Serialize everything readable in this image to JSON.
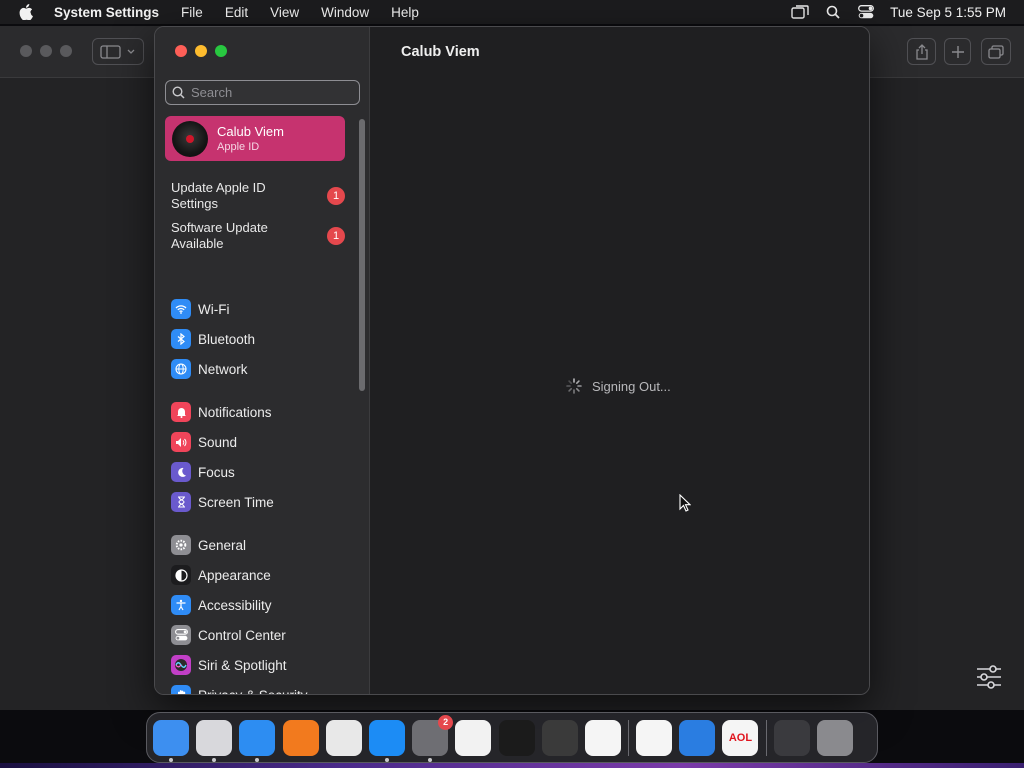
{
  "menubar": {
    "app_name": "System Settings",
    "items": [
      "File",
      "Edit",
      "View",
      "Window",
      "Help"
    ],
    "clock": "Tue Sep 5  1:55 PM",
    "icons": [
      "screen-mirroring-icon",
      "spotlight-search-icon",
      "control-center-icon"
    ]
  },
  "sidebar": {
    "search_placeholder": "Search",
    "account": {
      "name": "Calub Viem",
      "subtitle": "Apple ID"
    },
    "notices": [
      {
        "label": "Update Apple ID Settings",
        "badge": "1"
      },
      {
        "label": "Software Update Available",
        "badge": "1"
      }
    ],
    "items": [
      {
        "label": "Wi-Fi",
        "icon": "wifi-icon",
        "color": "#2f8cf6"
      },
      {
        "label": "Bluetooth",
        "icon": "bluetooth-icon",
        "color": "#2f8cf6"
      },
      {
        "label": "Network",
        "icon": "globe-icon",
        "color": "#2f8cf6"
      },
      {
        "label": "Notifications",
        "icon": "bell-icon",
        "color": "#f0455a"
      },
      {
        "label": "Sound",
        "icon": "speaker-icon",
        "color": "#f0455a"
      },
      {
        "label": "Focus",
        "icon": "moon-icon",
        "color": "#6a5acd"
      },
      {
        "label": "Screen Time",
        "icon": "hourglass-icon",
        "color": "#6a5acd"
      },
      {
        "label": "General",
        "icon": "gear-icon",
        "color": "#8e8e93"
      },
      {
        "label": "Appearance",
        "icon": "appearance-icon",
        "color": "#1c1c1e"
      },
      {
        "label": "Accessibility",
        "icon": "accessibility-icon",
        "color": "#2f8cf6"
      },
      {
        "label": "Control Center",
        "icon": "control-center-icon",
        "color": "#8e8e93"
      },
      {
        "label": "Siri & Spotlight",
        "icon": "siri-icon",
        "color": "#c23fc7"
      },
      {
        "label": "Privacy & Security",
        "icon": "hand-icon",
        "color": "#2f8cf6"
      }
    ]
  },
  "content": {
    "title": "Calub Viem",
    "status": "Signing Out..."
  },
  "dock": {
    "apps": [
      {
        "name": "Finder",
        "icon": "finder-icon",
        "color": "#3d8ff0"
      },
      {
        "name": "Launchpad",
        "icon": "launchpad-icon",
        "color": "#d8d8dc"
      },
      {
        "name": "Safari",
        "icon": "safari-icon",
        "color": "#2d8df2"
      },
      {
        "name": "Firefox",
        "icon": "firefox-icon",
        "color": "#f27a1e"
      },
      {
        "name": "Chrome",
        "icon": "chrome-icon",
        "color": "#e8e8e8"
      },
      {
        "name": "App Store",
        "icon": "app-store-icon",
        "color": "#1c8cf5"
      },
      {
        "name": "System Settings",
        "icon": "system-settings-icon",
        "color": "#6e6e73",
        "badge": "2"
      },
      {
        "name": "TextEdit",
        "icon": "textedit-icon",
        "color": "#f2f2f2"
      },
      {
        "name": "Terminal",
        "icon": "terminal-icon",
        "color": "#1b1b1b"
      },
      {
        "name": "GarageBand",
        "icon": "guitar-icon",
        "color": "#3a3a3a"
      },
      {
        "name": "VS Code",
        "icon": "vscode-icon",
        "color": "#f5f5f5"
      },
      {
        "name": "Visual Studio",
        "icon": "visual-studio-icon",
        "color": "#f5f5f5"
      },
      {
        "name": "Weather",
        "icon": "weather-icon",
        "color": "#2a7de1"
      },
      {
        "name": "AOL",
        "icon": "aol-icon",
        "color": "#f5f5f5",
        "text": "AOL"
      },
      {
        "name": "Downloads",
        "icon": "downloads-stack-icon",
        "color": "#3a3a3e"
      },
      {
        "name": "Trash",
        "icon": "trash-icon",
        "color": "#8a8a8e"
      }
    ]
  }
}
